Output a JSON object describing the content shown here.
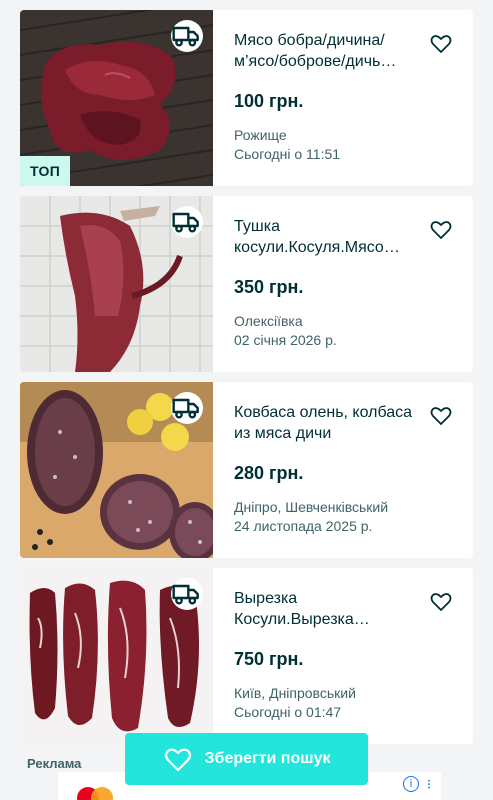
{
  "listings": [
    {
      "title": "Мясо бобра/дичина/м’ясо/боброве/дичь…",
      "price": "100 грн.",
      "location": "Рожище",
      "date": "Сьогодні о 11:51",
      "badge": "ТОП",
      "delivery_icon": "truck-icon",
      "favorite_icon": "heart-outline-icon"
    },
    {
      "title": "Тушка косули.Косуля.Мясо…",
      "price": "350 грн.",
      "location": "Олексіївка",
      "date": "02 січня 2026 р.",
      "delivery_icon": "truck-icon",
      "favorite_icon": "heart-outline-icon"
    },
    {
      "title": "Ковбаса олень, колбаса из мяса дичи",
      "price": "280 грн.",
      "location": "Дніпро, Шевченківський",
      "date": "24 листопада 2025 р.",
      "delivery_icon": "truck-icon",
      "favorite_icon": "heart-outline-icon"
    },
    {
      "title": "Вырезка Косули.Вырезка…",
      "price": "750 грн.",
      "location": "Київ, Дніпровський",
      "date": "Сьогодні о 01:47",
      "delivery_icon": "truck-icon",
      "favorite_icon": "heart-outline-icon"
    }
  ],
  "ad": {
    "label": "Реклама",
    "info_icon": "info-icon",
    "close_icon": "close-icon"
  },
  "save_search": {
    "label": "Зберегти пошук",
    "icon": "heart-outline-icon"
  },
  "colors": {
    "accent": "#23e5db",
    "text": "#002f34",
    "muted": "#406367",
    "badge_bg": "#cdf8f0",
    "background": "#f2f4f5"
  }
}
